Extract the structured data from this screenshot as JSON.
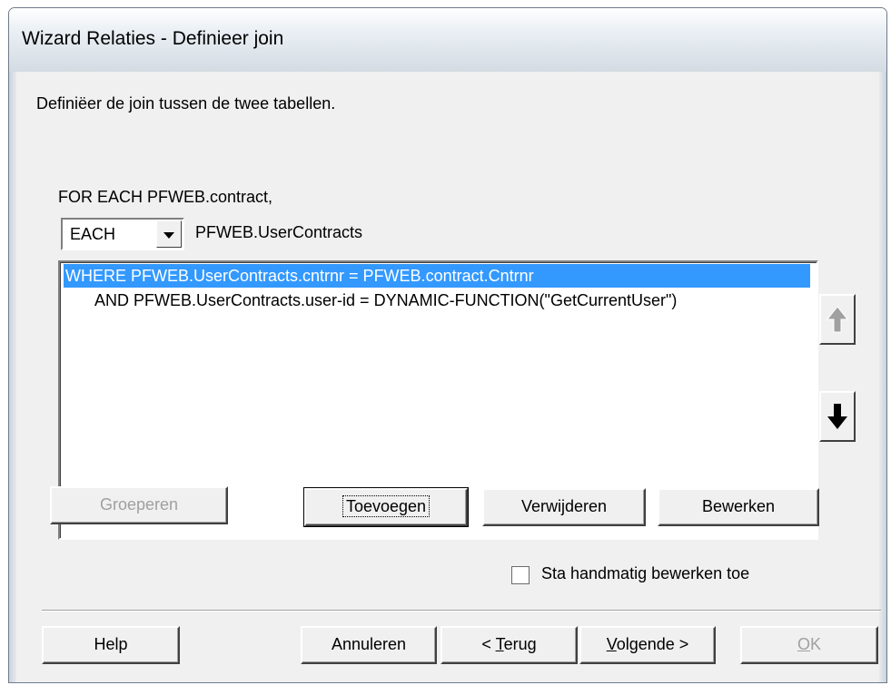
{
  "window": {
    "title": "Wizard Relaties - Definieer join"
  },
  "instruction": "Definiëer de join tussen de twee tabellen.",
  "for_each_line": "FOR EACH PFWEB.contract,",
  "join_type": {
    "selected": "EACH",
    "table": "PFWEB.UserContracts"
  },
  "where_clauses": [
    "WHERE PFWEB.UserContracts.cntrnr = PFWEB.contract.Cntrnr",
    "AND PFWEB.UserContracts.user-id = DYNAMIC-FUNCTION(\"GetCurrentUser\")"
  ],
  "buttons": {
    "group": "Groeperen",
    "add": "Toevoegen",
    "remove": "Verwijderen",
    "edit": "Bewerken"
  },
  "manual_edit_label": "Sta handmatig bewerken toe",
  "manual_edit_checked": false,
  "footer": {
    "help": "Help",
    "cancel": "Annuleren",
    "back_prefix": "< ",
    "back_underline": "T",
    "back_rest": "erug",
    "next_underline": "V",
    "next_rest": "olgende >",
    "ok_underline": "O",
    "ok_rest": "K"
  },
  "icons": {
    "move_up": "arrow-up-icon",
    "move_down": "arrow-down-icon",
    "dropdown": "chevron-down-icon"
  },
  "colors": {
    "selection": "#3399ff",
    "dialog_bg": "#f0f0f0"
  }
}
